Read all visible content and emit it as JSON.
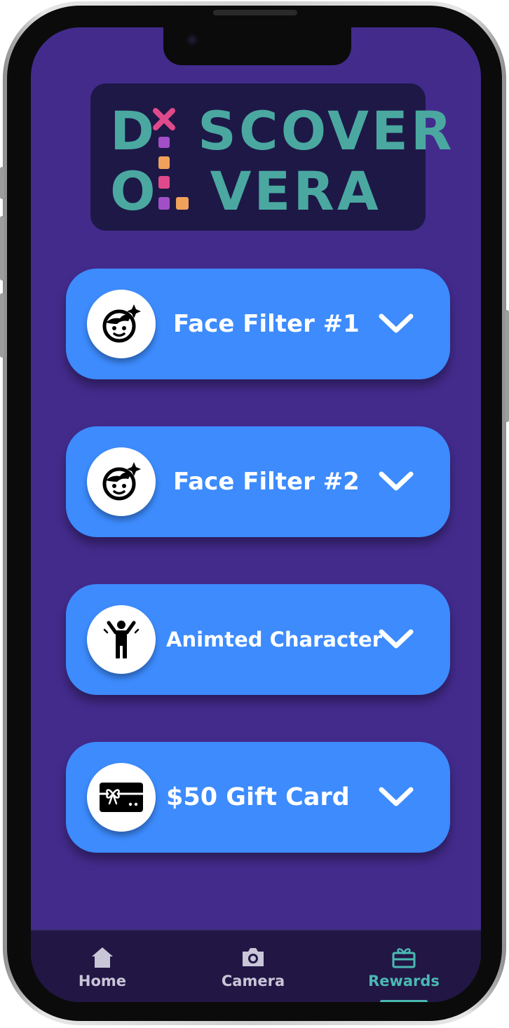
{
  "app": {
    "logo": {
      "line1": "DISCOVER",
      "line2": "OLIVERA",
      "line1_parts": [
        "D",
        "SCOVER"
      ],
      "line2_parts": [
        "O",
        "VERA"
      ],
      "text_color": "#4aa8a0",
      "accent_colors": [
        "#e04a8a",
        "#a24fc7",
        "#f0a15a"
      ]
    }
  },
  "colors": {
    "background": "#432b8c",
    "card": "#3d8bfd",
    "tabbar": "#221645",
    "active_tab": "#4ab9b2"
  },
  "rewards": [
    {
      "label": "Face Filter #1",
      "icon": "face-sparkle-icon"
    },
    {
      "label": "Face Filter #2",
      "icon": "face-sparkle-icon"
    },
    {
      "label": "Animted Character",
      "icon": "person-arms-up-icon"
    },
    {
      "label": "$50 Gift Card",
      "icon": "gift-card-icon"
    }
  ],
  "tabs": [
    {
      "label": "Home",
      "icon": "home-icon",
      "active": false
    },
    {
      "label": "Camera",
      "icon": "camera-icon",
      "active": false
    },
    {
      "label": "Rewards",
      "icon": "gift-icon",
      "active": true
    }
  ]
}
